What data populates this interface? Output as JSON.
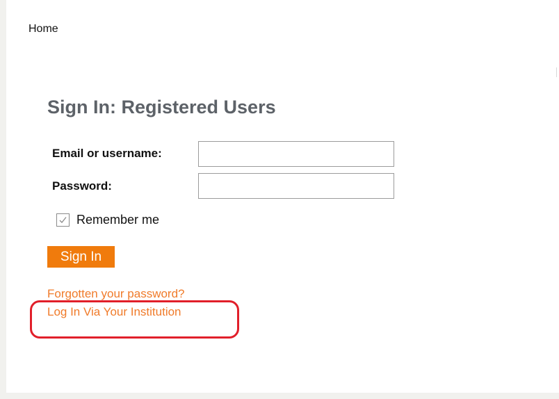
{
  "nav": {
    "home_label": "Home"
  },
  "signin": {
    "title": "Sign In: Registered Users",
    "email_label": "Email or username:",
    "email_value": "",
    "password_label": "Password:",
    "password_value": "",
    "remember_label": "Remember me",
    "remember_checked": true,
    "submit_label": "Sign In"
  },
  "links": {
    "forgot_password": "Forgotten your password?",
    "institution_login": "Log In Via Your Institution"
  },
  "colors": {
    "accent": "#f07b0c",
    "link": "#f07b2a",
    "annotation": "#e11f2a",
    "title": "#5d6268"
  }
}
